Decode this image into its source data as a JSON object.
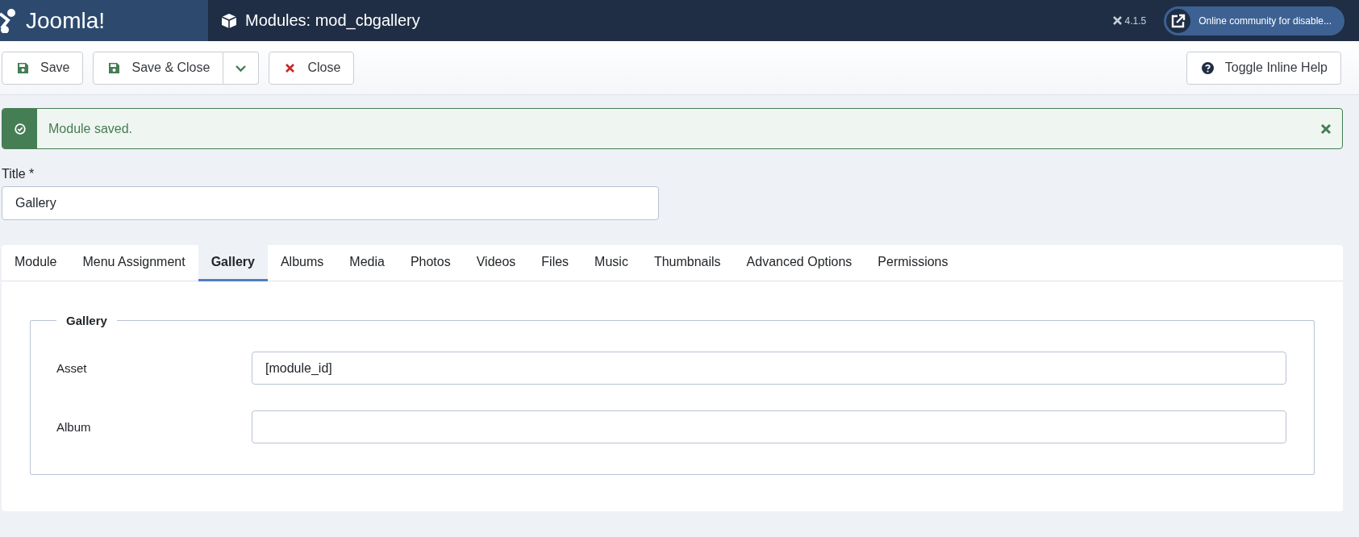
{
  "header": {
    "logo": "Joomla!",
    "title": "Modules: mod_cbgallery",
    "version": "4.1.5",
    "site_link": "Online community for disable..."
  },
  "toolbar": {
    "buttons": [
      {
        "label": "Save",
        "kind": "save"
      },
      {
        "label": "Save & Close",
        "kind": "save-split"
      },
      {
        "label": "Close",
        "kind": "close"
      }
    ],
    "help": "Toggle Inline Help"
  },
  "alert": {
    "message": "Module saved."
  },
  "title_field": {
    "label": "Title *",
    "value": "Gallery"
  },
  "tabs": [
    {
      "label": "Module",
      "selected": false
    },
    {
      "label": "Menu Assignment",
      "selected": false
    },
    {
      "label": "Gallery",
      "selected": true
    },
    {
      "label": "Albums",
      "selected": false
    },
    {
      "label": "Media",
      "selected": false
    },
    {
      "label": "Photos",
      "selected": false
    },
    {
      "label": "Videos",
      "selected": false
    },
    {
      "label": "Files",
      "selected": false
    },
    {
      "label": "Music",
      "selected": false
    },
    {
      "label": "Thumbnails",
      "selected": false
    },
    {
      "label": "Advanced Options",
      "selected": false
    },
    {
      "label": "Permissions",
      "selected": false
    }
  ],
  "fieldset": {
    "legend": "Gallery",
    "fields": [
      {
        "label": "Asset",
        "value": "[module_id]"
      },
      {
        "label": "Album"
      }
    ]
  }
}
